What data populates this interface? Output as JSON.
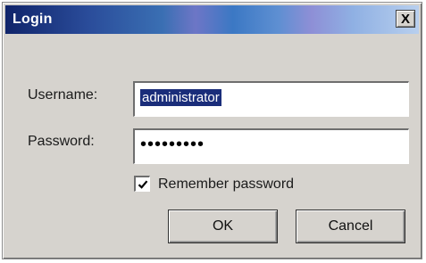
{
  "window": {
    "title": "Login",
    "close_label": "X"
  },
  "form": {
    "username_label": "Username:",
    "username_value": "administrator",
    "password_label": "Password:",
    "password_masked": "•••••••••",
    "remember_label": "Remember password",
    "remember_checked": true
  },
  "buttons": {
    "ok_label": "OK",
    "cancel_label": "Cancel"
  }
}
